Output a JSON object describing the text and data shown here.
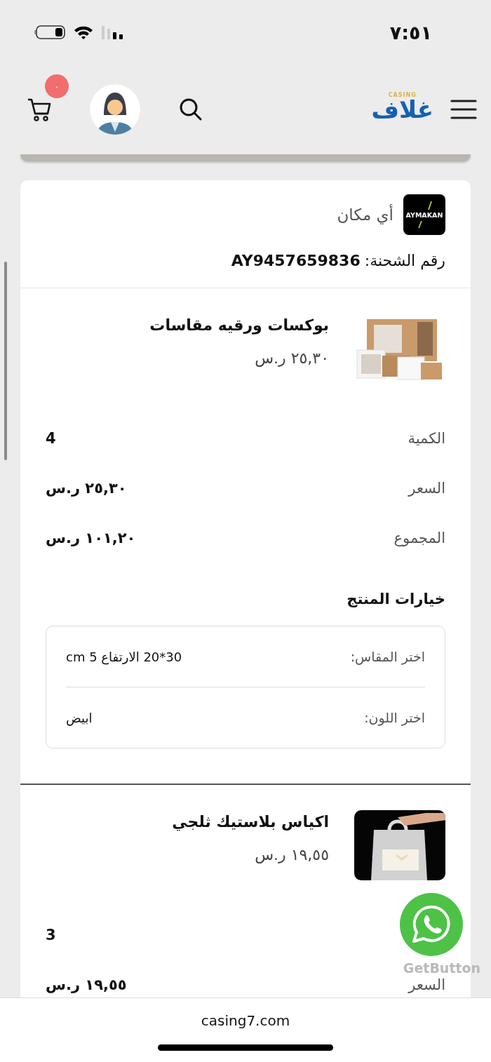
{
  "status_bar": {
    "time": "٧:٥١"
  },
  "header": {
    "logo": {
      "text": "غلاف",
      "tagline": "CASING"
    },
    "cart_count": "٠"
  },
  "shipment": {
    "courier": {
      "logo_text": "AYMAKAN",
      "name": "أي مكان"
    },
    "label": "رقم الشحنة:",
    "number": "AY9457659836"
  },
  "products": [
    {
      "title": "بوكسات ورقيه مقاسات",
      "price": "٢٥,٣٠ ر.س",
      "details": [
        {
          "label": "الكمية",
          "value": "4"
        },
        {
          "label": "السعر",
          "value": "٢٥,٣٠ ر.س"
        },
        {
          "label": "المجموع",
          "value": "١٠١,٢٠ ر.س"
        }
      ],
      "options": {
        "heading": "خيارات المنتج",
        "items": [
          {
            "label": "اختر المقاس:",
            "value": "30*20 الارتفاع 5 cm"
          },
          {
            "label": "اختر اللون:",
            "value": "ابيض"
          }
        ]
      }
    },
    {
      "title": "اكياس بلاستيك ثلجي",
      "price": "١٩,٥٥ ر.س",
      "details": [
        {
          "value": "3"
        },
        {
          "label": "السعر",
          "value": "١٩,٥٥ ر.س"
        }
      ]
    }
  ],
  "whatsapp": {
    "caption": "GetButton"
  },
  "browser_bar": {
    "url": "casing7.com"
  }
}
